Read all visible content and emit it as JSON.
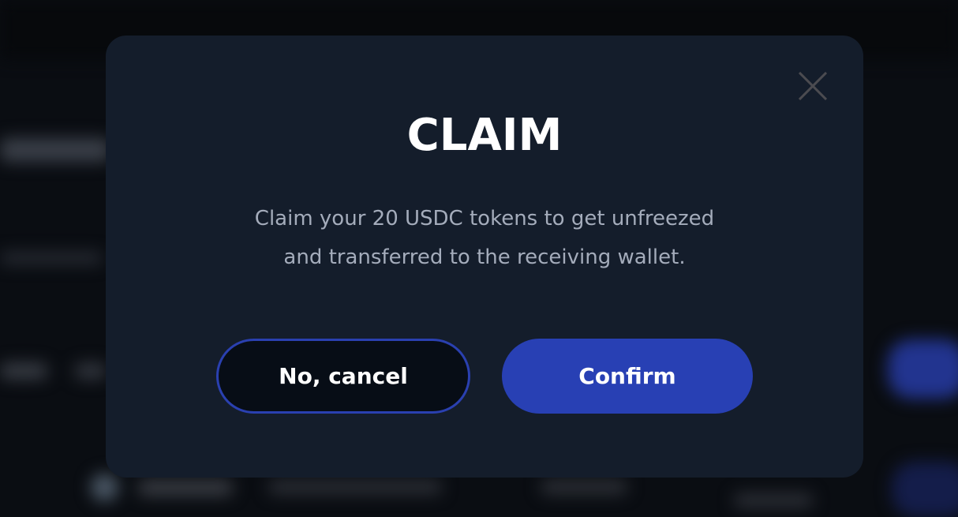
{
  "modal": {
    "title": "CLAIM",
    "message_line1": "Claim your 20 USDC tokens to get unfreezed",
    "message_line2": "and transferred to the receiving wallet.",
    "cancel_label": "No, cancel",
    "confirm_label": "Confirm",
    "close_icon": "close-icon"
  },
  "colors": {
    "accent": "#2840b4",
    "modal_bg": "#141d2b",
    "page_bg": "#0a0d12"
  }
}
